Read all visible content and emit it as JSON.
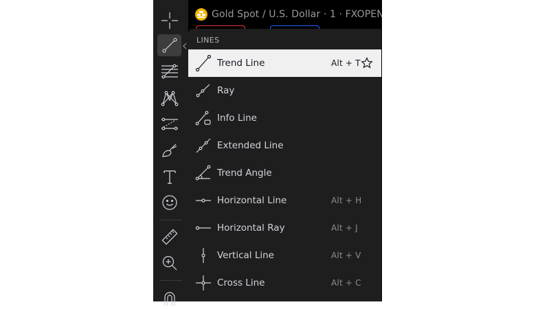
{
  "chart_header": {
    "symbol_title": "Gold Spot / U.S. Dollar · 1 · FXOPEN",
    "symbol_icon": "gold-bars-icon",
    "accent_colors": {
      "sell": "#e53935",
      "buy": "#2962ff",
      "logo": "#f0b400"
    }
  },
  "toolbar": {
    "tools": [
      {
        "name": "crosshair-icon"
      },
      {
        "name": "trend-line-icon",
        "active": true
      },
      {
        "name": "fib-retracement-icon"
      },
      {
        "name": "pattern-icon"
      },
      {
        "name": "prediction-measurement-icon"
      },
      {
        "name": "brush-icon"
      },
      {
        "name": "text-icon"
      },
      {
        "name": "emoji-icon"
      },
      {
        "name": "ruler-icon"
      },
      {
        "name": "zoom-in-icon"
      },
      {
        "name": "magnet-icon"
      }
    ],
    "expand_icon": "chevron-left-icon"
  },
  "lines_menu": {
    "header": "LINES",
    "items": [
      {
        "label": "Trend Line",
        "shortcut": "Alt + T",
        "icon": "trend-line-icon",
        "selected": true,
        "favorite_icon": "star-outline-icon"
      },
      {
        "label": "Ray",
        "shortcut": "",
        "icon": "ray-icon"
      },
      {
        "label": "Info Line",
        "shortcut": "",
        "icon": "info-line-icon"
      },
      {
        "label": "Extended Line",
        "shortcut": "",
        "icon": "extended-line-icon"
      },
      {
        "label": "Trend Angle",
        "shortcut": "",
        "icon": "trend-angle-icon"
      },
      {
        "label": "Horizontal Line",
        "shortcut": "Alt + H",
        "icon": "horizontal-line-icon"
      },
      {
        "label": "Horizontal Ray",
        "shortcut": "Alt + J",
        "icon": "horizontal-ray-icon"
      },
      {
        "label": "Vertical Line",
        "shortcut": "Alt + V",
        "icon": "vertical-line-icon"
      },
      {
        "label": "Cross Line",
        "shortcut": "Alt + C",
        "icon": "cross-line-icon"
      }
    ]
  }
}
